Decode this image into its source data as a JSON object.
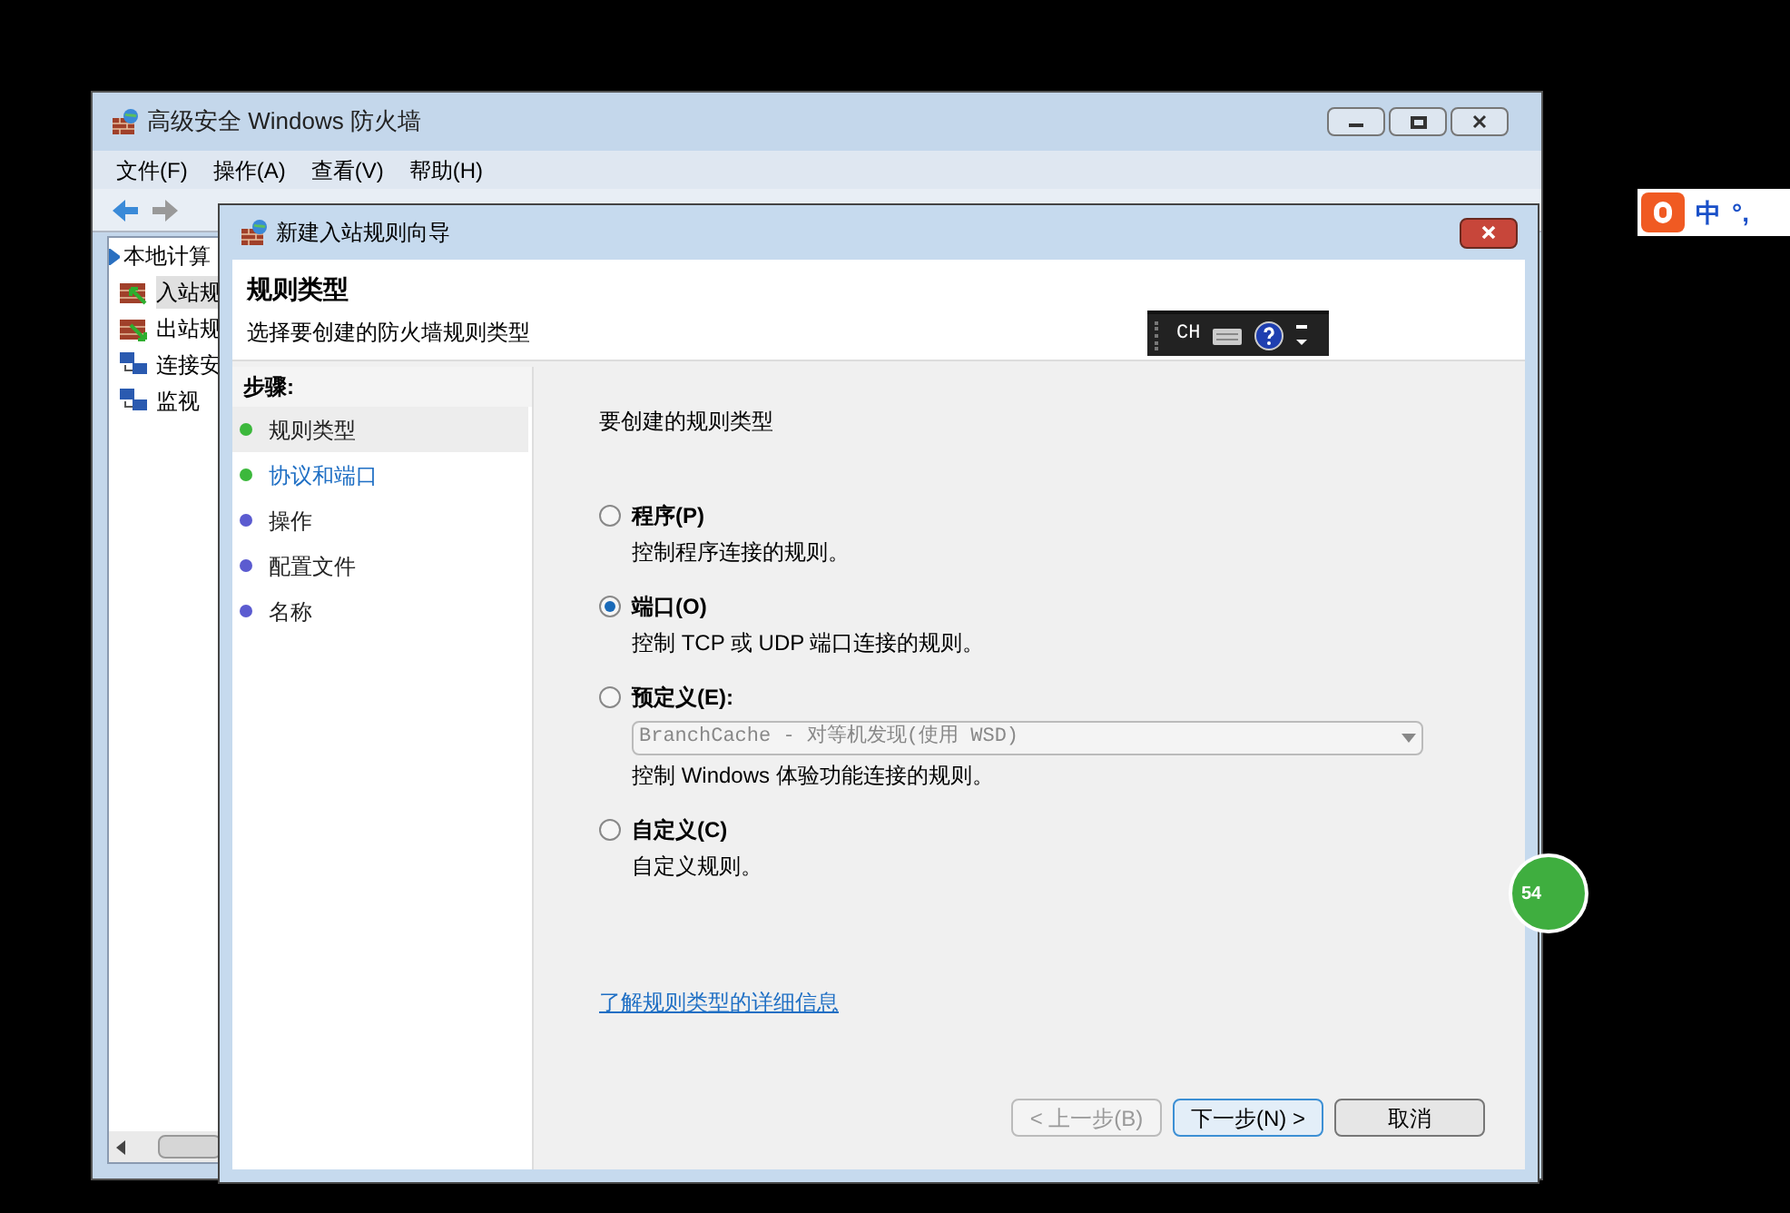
{
  "main_window": {
    "title": "高级安全 Windows 防火墙",
    "menu": [
      "文件(F)",
      "操作(A)",
      "查看(V)",
      "帮助(H)"
    ],
    "tree": [
      {
        "label": "本地计算",
        "expanded": true,
        "children": [
          {
            "label": "入站规",
            "selected": true
          },
          {
            "label": "出站规",
            "selected": false
          },
          {
            "label": "连接安",
            "selected": false
          },
          {
            "label": "监视",
            "selected": false
          }
        ]
      }
    ]
  },
  "dialog": {
    "title": "新建入站规则向导",
    "heading": "规则类型",
    "subtitle": "选择要创建的防火墙规则类型",
    "language_bar": {
      "label": "CH"
    },
    "steps_title": "步骤:",
    "steps": [
      {
        "label": "规则类型",
        "color": "#3cb83c",
        "selected": true,
        "link": false
      },
      {
        "label": "协议和端口",
        "color": "#3cb83c",
        "selected": false,
        "link": true
      },
      {
        "label": "操作",
        "color": "#5b5bd0",
        "selected": false,
        "link": false
      },
      {
        "label": "配置文件",
        "color": "#5b5bd0",
        "selected": false,
        "link": false
      },
      {
        "label": "名称",
        "color": "#5b5bd0",
        "selected": false,
        "link": false
      }
    ],
    "prompt": "要创建的规则类型",
    "options": [
      {
        "label": "程序(P)",
        "description": "控制程序连接的规则。",
        "selected": false
      },
      {
        "label": "端口(O)",
        "description": "控制 TCP 或 UDP 端口连接的规则。",
        "selected": true
      },
      {
        "label": "预定义(E):",
        "dropdown": {
          "value": "BranchCache - 对等机发现(使用 WSD)",
          "disabled": true
        },
        "description": "控制 Windows 体验功能连接的规则。",
        "selected": false
      },
      {
        "label": "自定义(C)",
        "description": "自定义规则。",
        "selected": false
      }
    ],
    "help_link": "了解规则类型的详细信息",
    "buttons": [
      {
        "label": "< 上一步(B)",
        "disabled": true,
        "default": false
      },
      {
        "label": "下一步(N) >",
        "disabled": false,
        "default": true
      },
      {
        "label": "取消",
        "disabled": false,
        "default": false
      }
    ]
  },
  "ime_bar": {
    "items": [
      "中",
      "°,"
    ]
  },
  "badge": {
    "label": "54"
  }
}
